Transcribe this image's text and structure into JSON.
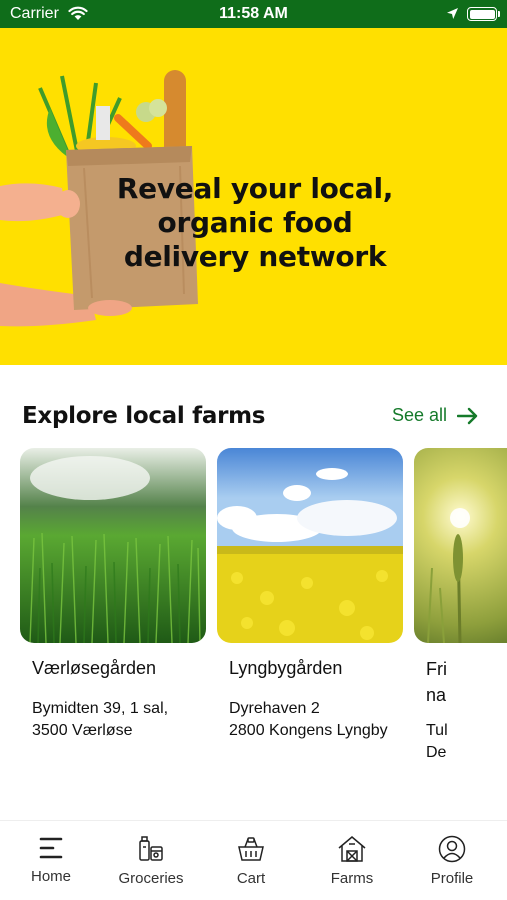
{
  "status_bar": {
    "carrier": "Carrier",
    "time": "11:58 AM",
    "icons": [
      "wifi-icon",
      "location-arrow-icon",
      "battery-icon"
    ]
  },
  "hero": {
    "title": "Reveal your local, organic food delivery network",
    "background_color": "#ffe000"
  },
  "farms_section": {
    "title": "Explore local farms",
    "see_all_label": "See all",
    "see_all_icon": "arrow-right-icon",
    "accent_color": "#157a2a",
    "farms": [
      {
        "name": "Værløsegården",
        "address_line1": "Bymidten 39, 1 sal,",
        "address_line2": "3500  Værløse",
        "image": "green-grass-field"
      },
      {
        "name": "Lyngbygården",
        "address_line1": "Dyrehaven 2",
        "address_line2": "2800 Kongens Lyngby",
        "image": "yellow-rapeseed-field"
      },
      {
        "name": "Fri na",
        "address_line1": "Tul",
        "address_line2": "De",
        "image": "wheat-field-sunset"
      }
    ]
  },
  "tab_bar": {
    "tabs": [
      {
        "label": "Home",
        "icon": "home-menu-icon"
      },
      {
        "label": "Groceries",
        "icon": "groceries-icon"
      },
      {
        "label": "Cart",
        "icon": "basket-icon"
      },
      {
        "label": "Farms",
        "icon": "barn-icon"
      },
      {
        "label": "Profile",
        "icon": "profile-icon"
      }
    ]
  }
}
